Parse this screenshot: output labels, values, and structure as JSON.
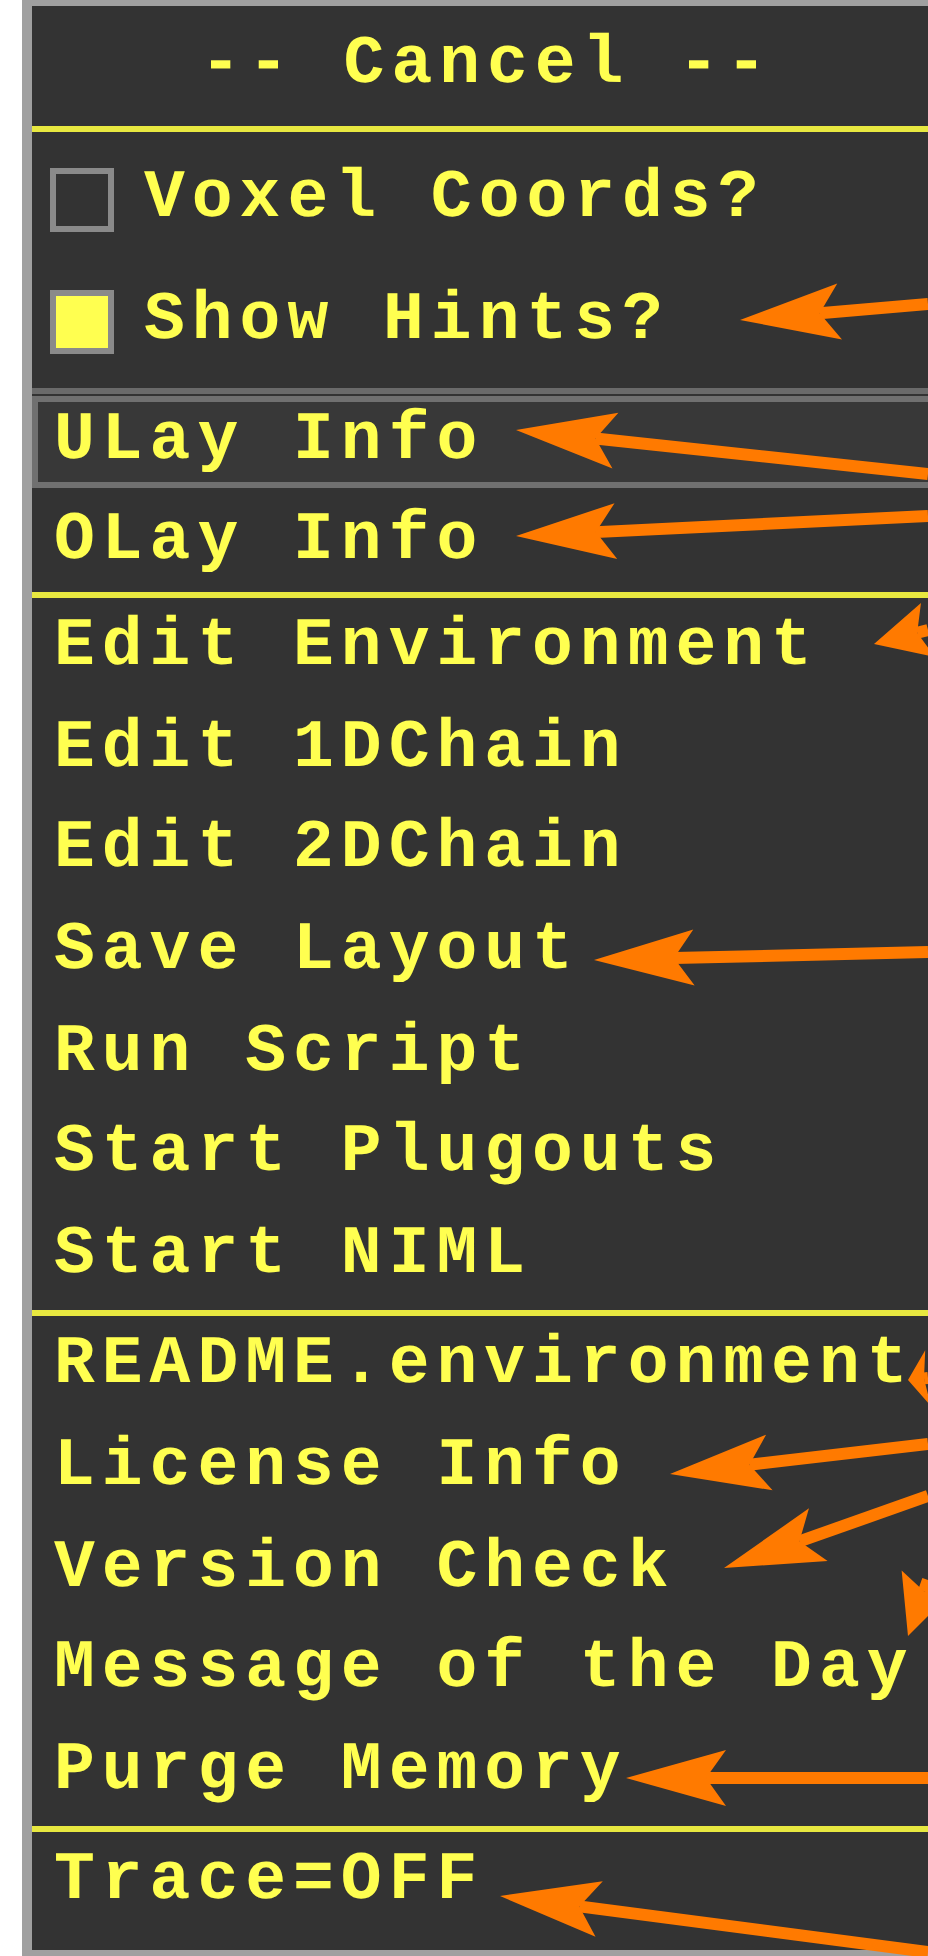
{
  "header": {
    "label": "-- Cancel --"
  },
  "toggles": [
    {
      "label": "Voxel Coords?",
      "checked": false
    },
    {
      "label": "Show Hints?",
      "checked": true
    }
  ],
  "groups": [
    [
      {
        "label": "ULay Info",
        "selected": true
      },
      {
        "label": "OLay Info",
        "selected": false
      }
    ],
    [
      {
        "label": "Edit Environment",
        "selected": false
      },
      {
        "label": "Edit 1DChain",
        "selected": false
      },
      {
        "label": "Edit 2DChain",
        "selected": false
      },
      {
        "label": "Save Layout",
        "selected": false
      },
      {
        "label": "Run Script",
        "selected": false
      },
      {
        "label": "Start Plugouts",
        "selected": false
      },
      {
        "label": "Start NIML",
        "selected": false
      }
    ],
    [
      {
        "label": "README.environment",
        "selected": false
      },
      {
        "label": "License Info",
        "selected": false
      },
      {
        "label": "Version Check",
        "selected": false
      },
      {
        "label": "Message of the Day",
        "selected": false
      },
      {
        "label": "Purge Memory",
        "selected": false
      }
    ],
    [
      {
        "label": "Trace=OFF",
        "selected": false
      }
    ]
  ]
}
